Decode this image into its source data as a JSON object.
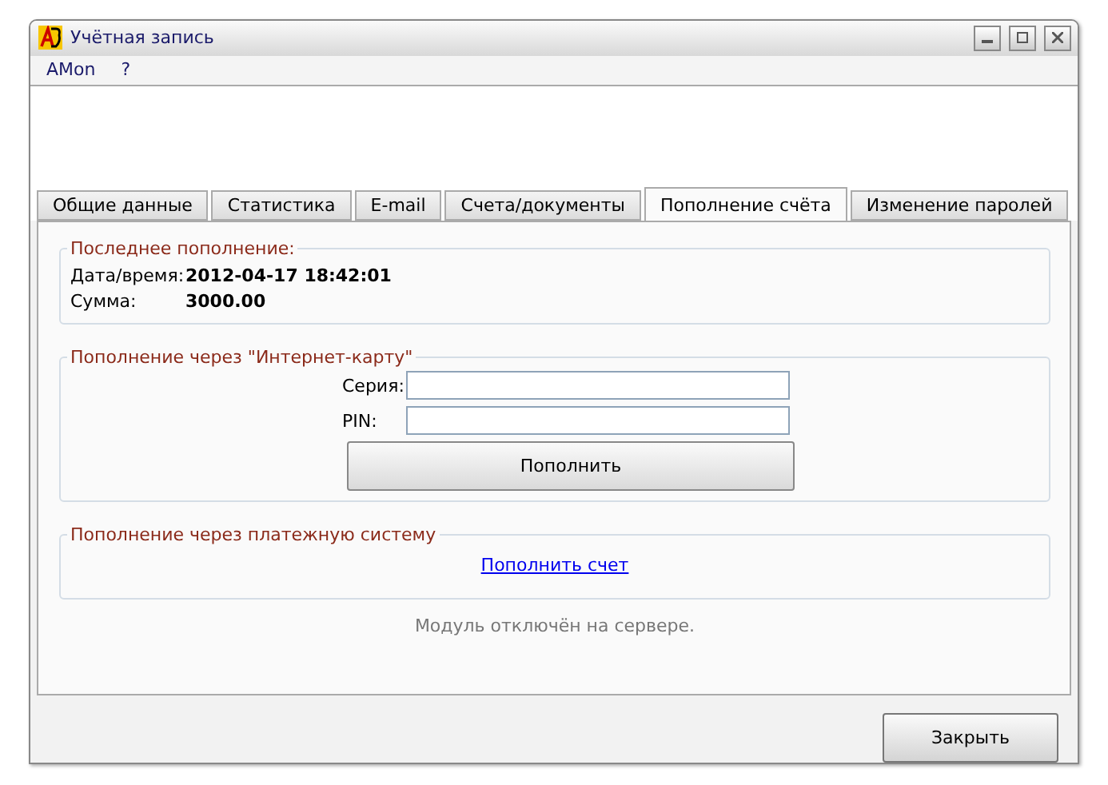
{
  "window": {
    "title": "Учётная запись"
  },
  "menu": [
    "AMon",
    "?"
  ],
  "tabs": [
    {
      "label": "Общие данные",
      "selected": false
    },
    {
      "label": "Статистика",
      "selected": false
    },
    {
      "label": "E-mail",
      "selected": false
    },
    {
      "label": "Счета/документы",
      "selected": false
    },
    {
      "label": "Пополнение счёта",
      "selected": true
    },
    {
      "label": "Изменение паролей",
      "selected": false
    }
  ],
  "last_topup": {
    "title": "Последнее пополнение:",
    "rows": [
      {
        "label": "Дата/время:",
        "value": "2012-04-17 18:42:01"
      },
      {
        "label": "Сумма:",
        "value": "3000.00"
      }
    ]
  },
  "card_topup": {
    "title": "Пополнение через \"Интернет-карту\"",
    "fields": [
      {
        "label": "Серия:"
      },
      {
        "label": "PIN:"
      }
    ],
    "button": "Пополнить"
  },
  "payment_system": {
    "title": "Пополнение через платежную систему",
    "link": "Пополнить счет"
  },
  "status": "Модуль отключён на сервере.",
  "buttons": [
    "Закрыть"
  ]
}
